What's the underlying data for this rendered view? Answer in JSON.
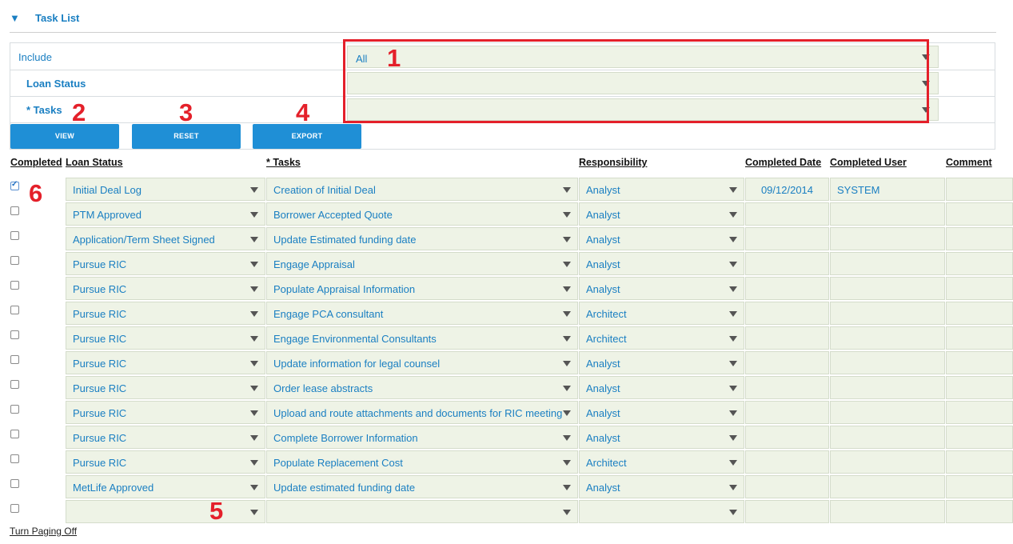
{
  "header": {
    "toggle_icon": "triangle-down-icon",
    "title": "Task List"
  },
  "filters": [
    {
      "label": "Include",
      "value": "All"
    },
    {
      "label": "Loan Status",
      "value": ""
    },
    {
      "label": "* Tasks",
      "value": ""
    }
  ],
  "buttons": {
    "view": "VIEW",
    "reset": "RESET",
    "export": "EXPORT"
  },
  "annotations": [
    "1",
    "2",
    "3",
    "4",
    "5",
    "6"
  ],
  "columns": [
    "Completed",
    "Loan Status",
    "* Tasks",
    "Responsibility",
    "Completed Date",
    "Completed User",
    "Comment"
  ],
  "rows": [
    {
      "checked": true,
      "status": "Initial Deal Log",
      "task": "Creation of Initial Deal",
      "resp": "Analyst",
      "date": "09/12/2014",
      "user": "SYSTEM"
    },
    {
      "checked": false,
      "status": "PTM Approved",
      "task": "Borrower Accepted Quote",
      "resp": "Analyst",
      "date": "",
      "user": ""
    },
    {
      "checked": false,
      "status": "Application/Term Sheet Signed",
      "task": "Update Estimated funding date",
      "resp": "Analyst",
      "date": "",
      "user": ""
    },
    {
      "checked": false,
      "status": "Pursue RIC",
      "task": "Engage Appraisal",
      "resp": "Analyst",
      "date": "",
      "user": ""
    },
    {
      "checked": false,
      "status": "Pursue RIC",
      "task": "Populate Appraisal Information",
      "resp": "Analyst",
      "date": "",
      "user": ""
    },
    {
      "checked": false,
      "status": "Pursue RIC",
      "task": "Engage PCA consultant",
      "resp": "Architect",
      "date": "",
      "user": ""
    },
    {
      "checked": false,
      "status": "Pursue RIC",
      "task": "Engage Environmental Consultants",
      "resp": "Architect",
      "date": "",
      "user": ""
    },
    {
      "checked": false,
      "status": "Pursue RIC",
      "task": "Update information for legal counsel",
      "resp": "Analyst",
      "date": "",
      "user": ""
    },
    {
      "checked": false,
      "status": "Pursue RIC",
      "task": "Order lease abstracts",
      "resp": "Analyst",
      "date": "",
      "user": ""
    },
    {
      "checked": false,
      "status": "Pursue RIC",
      "task": "Upload and route attachments and documents for RIC meeting",
      "resp": "Analyst",
      "date": "",
      "user": ""
    },
    {
      "checked": false,
      "status": "Pursue RIC",
      "task": "Complete Borrower Information",
      "resp": "Analyst",
      "date": "",
      "user": ""
    },
    {
      "checked": false,
      "status": "Pursue RIC",
      "task": "Populate Replacement Cost",
      "resp": "Architect",
      "date": "",
      "user": ""
    },
    {
      "checked": false,
      "status": "MetLife Approved",
      "task": "Update estimated funding date",
      "resp": "Analyst",
      "date": "",
      "user": ""
    },
    {
      "checked": false,
      "status": "",
      "task": "",
      "resp": "",
      "date": "",
      "user": ""
    }
  ],
  "footer": {
    "paging_link": "Turn Paging Off"
  },
  "colors": {
    "accent": "#1f8fd6",
    "field_bg": "#eef3e6",
    "annotation": "#e4202a"
  }
}
